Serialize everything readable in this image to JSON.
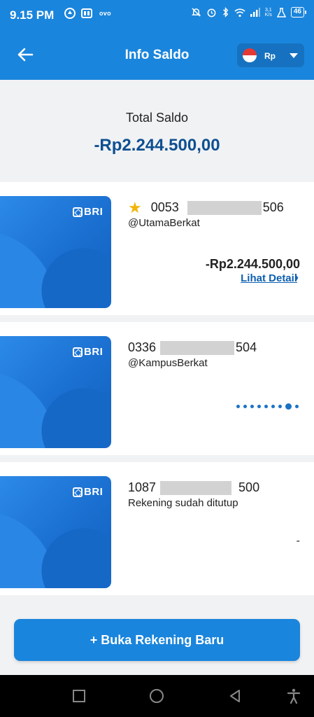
{
  "status_bar": {
    "time": "9.15 PM",
    "ovo": "ovo",
    "speed_top": "3,1",
    "speed_bottom": "K/s",
    "battery": "46"
  },
  "header": {
    "title": "Info Saldo",
    "currency_code": "Rp"
  },
  "total": {
    "label": "Total Saldo",
    "amount": "-Rp2.244.500,00"
  },
  "accounts": [
    {
      "bank": "BRI",
      "number_prefix": "0053",
      "number_suffix": "506",
      "favorite": true,
      "alias": "@UtamaBerkat",
      "balance": "-Rp2.244.500,00",
      "detail_link": "Lihat Detail"
    },
    {
      "bank": "BRI",
      "number_prefix": "0336",
      "number_suffix": "504",
      "alias": "@KampusBerkat",
      "loading": true
    },
    {
      "bank": "BRI",
      "number_prefix": "1087",
      "number_suffix": "500",
      "alias": "Rekening sudah ditutup",
      "balance": "-"
    }
  ],
  "action": {
    "open_account_label": "+ Buka Rekening Baru"
  },
  "colors": {
    "primary": "#1a85dc",
    "amount_blue": "#0e4f91",
    "link_blue": "#0e5fb0",
    "star": "#f2b50b"
  }
}
